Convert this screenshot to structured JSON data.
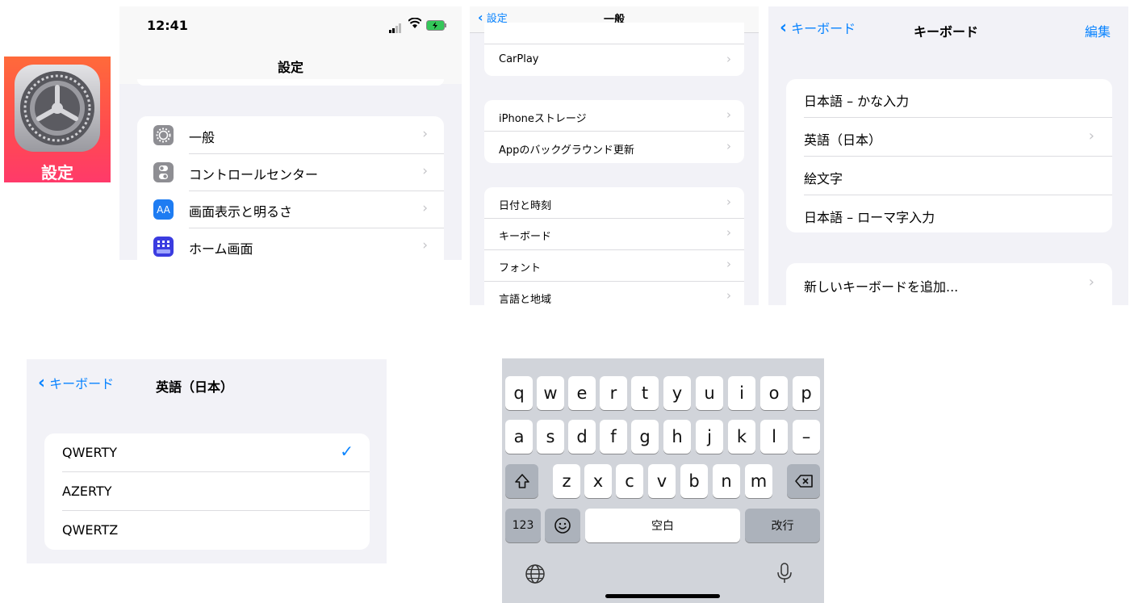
{
  "app_icon": {
    "label": "設定",
    "gradient_top": "#ff6a3a",
    "gradient_bottom": "#ff3a6a",
    "icon": "gear-icon"
  },
  "settings": {
    "time": "12:41",
    "title": "設定",
    "items": [
      {
        "label": "一般",
        "icon": "gear-icon",
        "icon_bg": "#8e8e93"
      },
      {
        "label": "コントロールセンター",
        "icon": "toggle-icon",
        "icon_bg": "#8e8e93"
      },
      {
        "label": "画面表示と明るさ",
        "icon": "text-size-icon",
        "icon_bg": "#1e7cf2",
        "icon_text": "AA"
      },
      {
        "label": "ホーム画面",
        "icon": "home-grid-icon",
        "icon_bg": "#3b3ce0"
      }
    ]
  },
  "general": {
    "back_label": "設定",
    "title": "一般",
    "groups": [
      [
        "CarPlay"
      ],
      [
        "iPhoneストレージ",
        "Appのバックグラウンド更新"
      ],
      [
        "日付と時刻",
        "キーボード",
        "フォント",
        "言語と地域"
      ]
    ]
  },
  "keyboards": {
    "back_label": "キーボード",
    "title": "キーボード",
    "edit_label": "編集",
    "items": [
      {
        "label": "日本語 – かな入力",
        "chevron": false
      },
      {
        "label": "英語（日本）",
        "chevron": true
      },
      {
        "label": "絵文字",
        "chevron": false
      },
      {
        "label": "日本語 – ローマ字入力",
        "chevron": false
      }
    ],
    "add_label": "新しいキーボードを追加..."
  },
  "english_jp": {
    "back_label": "キーボード",
    "title": "英語（日本）",
    "layouts": [
      {
        "label": "QWERTY",
        "selected": true
      },
      {
        "label": "AZERTY",
        "selected": false
      },
      {
        "label": "QWERTZ",
        "selected": false
      }
    ]
  },
  "keyboard": {
    "row1": [
      "q",
      "w",
      "e",
      "r",
      "t",
      "y",
      "u",
      "i",
      "o",
      "p"
    ],
    "row2": [
      "a",
      "s",
      "d",
      "f",
      "g",
      "h",
      "j",
      "k",
      "l",
      "–"
    ],
    "row3": [
      "z",
      "x",
      "c",
      "v",
      "b",
      "n",
      "m"
    ],
    "numbers_key": "123",
    "space_key": "空白",
    "return_key": "改行"
  },
  "colors": {
    "accent": "#0a84ff",
    "group_bg": "#f2f2f7",
    "keyboard_bg": "#d1d4da"
  }
}
